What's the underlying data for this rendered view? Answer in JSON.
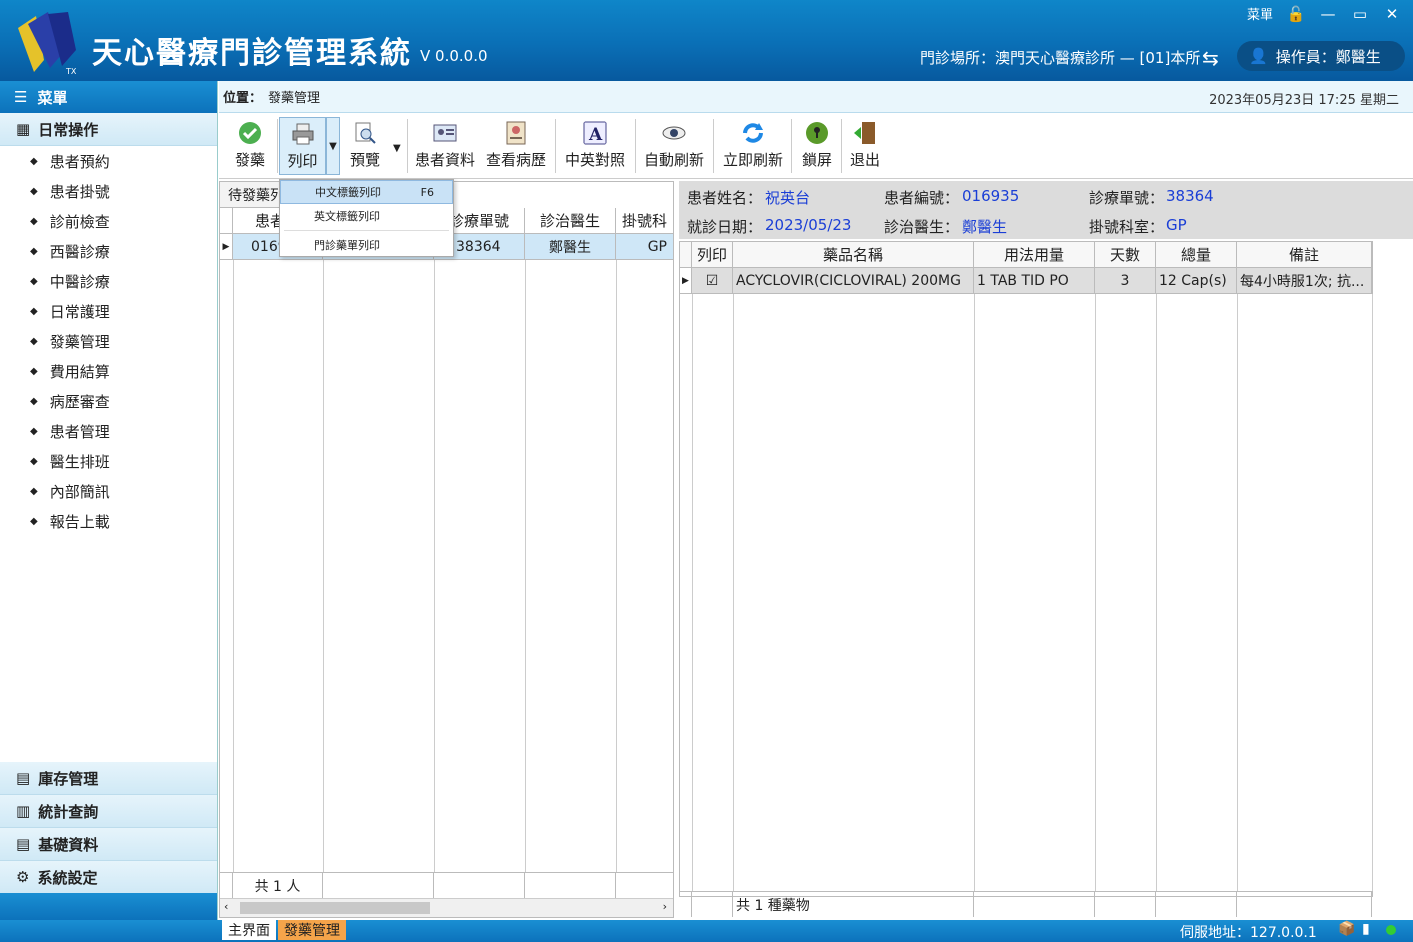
{
  "window": {
    "title": "天心醫療門診管理系統",
    "version": "V 0.0.0.0",
    "menu_label": "菜單",
    "clinic_info": "門診場所：澳門天心醫療診所 — [01]本所",
    "operator": "操作員：鄭醫生"
  },
  "sidebar": {
    "header": "菜單",
    "group_daily": "日常操作",
    "items": [
      {
        "label": "患者預約"
      },
      {
        "label": "患者掛號"
      },
      {
        "label": "診前檢查"
      },
      {
        "label": "西醫診療"
      },
      {
        "label": "中醫診療"
      },
      {
        "label": "日常護理"
      },
      {
        "label": "發藥管理"
      },
      {
        "label": "費用結算"
      },
      {
        "label": "病歷審查"
      },
      {
        "label": "患者管理"
      },
      {
        "label": "醫生排班"
      },
      {
        "label": "內部簡訊"
      },
      {
        "label": "報告上載"
      }
    ],
    "lower_groups": [
      {
        "label": "庫存管理"
      },
      {
        "label": "統計查詢"
      },
      {
        "label": "基礎資料"
      },
      {
        "label": "系統設定"
      }
    ]
  },
  "breadcrumb": {
    "label": "位置：",
    "path": "發藥管理",
    "datetime": "2023年05月23日 17:25 星期二"
  },
  "toolbar": {
    "dispense": "發藥",
    "print": "列印",
    "preview": "預覽",
    "patient_info": "患者資料",
    "view_history": "查看病歷",
    "cn_en": "中英對照",
    "auto_refresh": "自動刷新",
    "refresh_now": "立即刷新",
    "lock_screen": "鎖屏",
    "exit": "退出"
  },
  "print_menu": {
    "items": [
      {
        "label": "中文標籤列印",
        "shortcut": "F6"
      },
      {
        "label": "英文標籤列印",
        "shortcut": ""
      },
      {
        "label": "門診藥單列印",
        "shortcut": ""
      }
    ]
  },
  "queue": {
    "tab": "待發藥列",
    "columns": [
      "患者編",
      "",
      "診療單號",
      "診治醫生",
      "掛號科"
    ],
    "rows": [
      {
        "patient_id": "0169",
        "name": "",
        "order_no": "38364",
        "doctor": "鄭醫生",
        "dept": "GP"
      }
    ],
    "footer": "共 1 人"
  },
  "patient": {
    "name_label": "患者姓名：",
    "name": "祝英台",
    "id_label": "患者編號：",
    "id": "016935",
    "order_label": "診療單號：",
    "order": "38364",
    "date_label": "就診日期：",
    "date": "2023/05/23",
    "doctor_label": "診治醫生：",
    "doctor": "鄭醫生",
    "dept_label": "掛號科室：",
    "dept": "GP"
  },
  "drugs": {
    "columns": [
      "列印",
      "藥品名稱",
      "用法用量",
      "天數",
      "總量",
      "備註"
    ],
    "rows": [
      {
        "print": "☑",
        "name": "ACYCLOVIR(CICLOVIRAL) 200MG",
        "usage": "1 TAB TID PO",
        "days": "3",
        "total": "12 Cap(s)",
        "note": "每4小時服1次; 抗..."
      }
    ],
    "footer": "共 1 種藥物"
  },
  "statusbar": {
    "tab_main": "主界面",
    "tab_dispense": "發藥管理",
    "server": "伺服地址：127.0.0.1"
  },
  "colors": {
    "title_blue": "#0a6fb6",
    "link_blue": "#1a3ed6",
    "selected_row": "#cfe7f7"
  }
}
